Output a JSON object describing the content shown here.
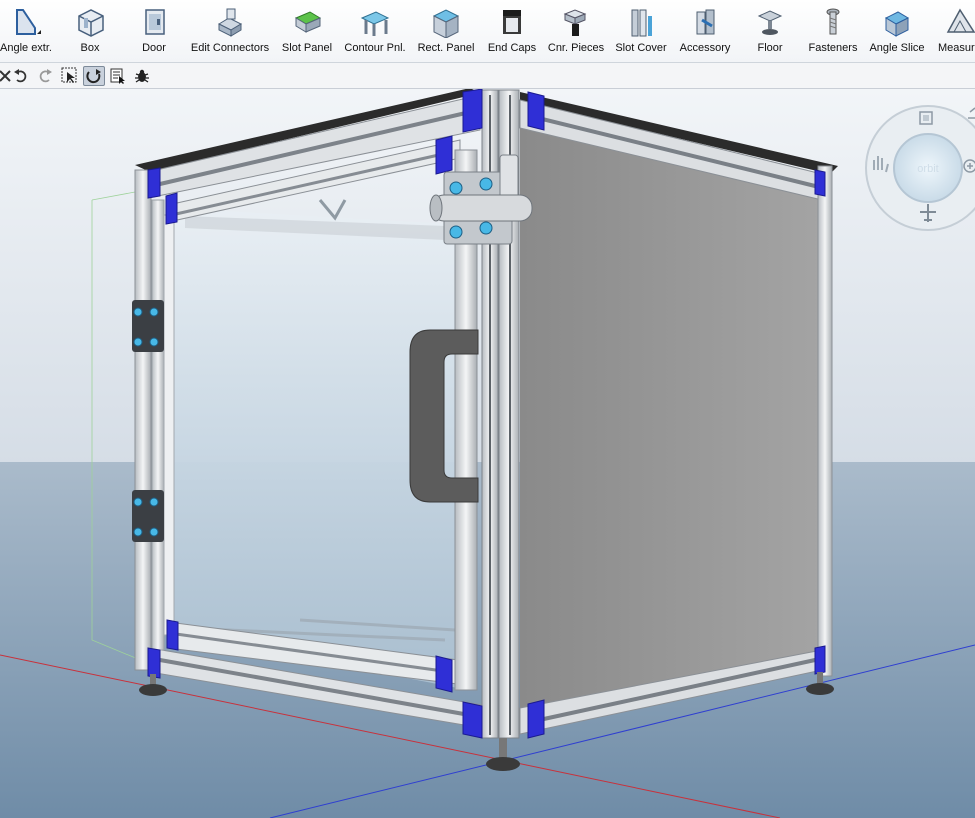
{
  "ribbon": {
    "items": [
      {
        "label": "Angle extr.",
        "icon": "angle-extrusion-icon"
      },
      {
        "label": "Box",
        "icon": "box-frame-icon"
      },
      {
        "label": "Door",
        "icon": "door-icon"
      },
      {
        "label": "Edit Connectors",
        "icon": "edit-connectors-icon"
      },
      {
        "label": "Slot Panel",
        "icon": "slot-panel-icon"
      },
      {
        "label": "Contour Pnl.",
        "icon": "contour-panel-icon"
      },
      {
        "label": "Rect. Panel",
        "icon": "rect-panel-icon"
      },
      {
        "label": "End Caps",
        "icon": "end-caps-icon"
      },
      {
        "label": "Cnr. Pieces",
        "icon": "corner-pieces-icon"
      },
      {
        "label": "Slot Cover",
        "icon": "slot-cover-icon"
      },
      {
        "label": "Accessory",
        "icon": "accessory-icon"
      },
      {
        "label": "Floor",
        "icon": "floor-icon"
      },
      {
        "label": "Fasteners",
        "icon": "fasteners-icon"
      },
      {
        "label": "Angle Slice",
        "icon": "angle-slice-icon"
      },
      {
        "label": "Measure",
        "icon": "measure-icon"
      }
    ]
  },
  "quickbar": {
    "items": [
      {
        "icon": "close-icon",
        "active": false
      },
      {
        "icon": "undo-icon",
        "active": false
      },
      {
        "icon": "redo-icon",
        "active": false
      },
      {
        "icon": "select-grid-icon",
        "active": false
      },
      {
        "icon": "snap-rotate-icon",
        "active": true
      },
      {
        "icon": "pointer-document-icon",
        "active": false
      },
      {
        "icon": "bug-icon",
        "active": false
      }
    ]
  },
  "navigation_widget": {
    "center_label": "orbit",
    "icons": [
      "view-cube-icon",
      "zoom-icon",
      "pan-hand-icon",
      "fly-icon"
    ]
  },
  "scene": {
    "object": "aluminum-profile-enclosure",
    "colors": {
      "sky": "#dfe6ed",
      "ground": "#7f9bb5",
      "profile": "#d9dcdf",
      "corner_connector": "#2f2fd6",
      "side_panel": "#9a9a9a",
      "glass": "#c9d8e4",
      "top_edge": "#2b2b2b",
      "x_axis": "#c8313b",
      "y_axis": "#2f3fd0"
    }
  }
}
